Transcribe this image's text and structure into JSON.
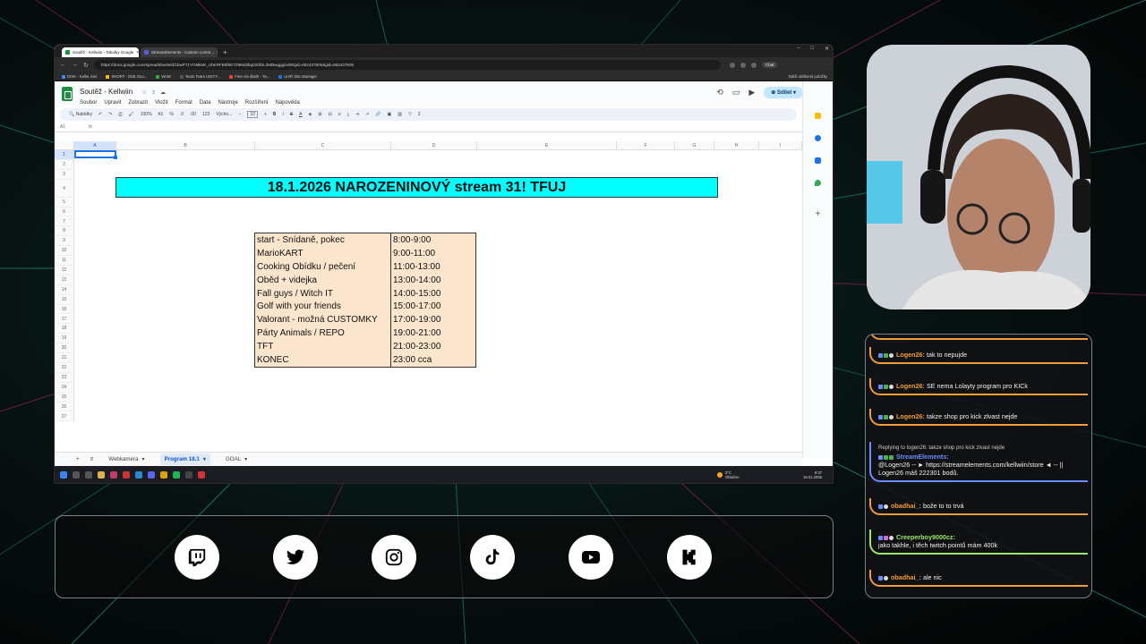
{
  "browser": {
    "tabs": [
      {
        "label": "Soutěž - Kellwiin - Tabulky Google",
        "color": "#1e8e3e",
        "active": true
      },
      {
        "label": "StreamElements - Custom comm...",
        "color": "#5b5bd6",
        "active": false
      }
    ],
    "url": "https://docs.google.com/spreadsheets/d/1bwP71YOMkMr_UhKRFB0f5E7Z9Md3bq020fSL3MBwggg/edit#gid=662437605&gid=662437605",
    "chat_button": "Chat",
    "bookmarks": [
      {
        "label": "DISK - Kellw. Kiei",
        "color": "#4285f4"
      },
      {
        "label": "SHORT - Disk Goo...",
        "color": "#fbbc04"
      },
      {
        "label": "WoW",
        "color": "#34a853"
      },
      {
        "label": "Team Team UNITY...",
        "color": "#555555"
      },
      {
        "label": "Free elo dlash - Ta...",
        "color": "#ea4335"
      },
      {
        "label": "UniFi Site Manager",
        "color": "#1a73e8"
      }
    ],
    "bookmarks_right": "Další oblíbené položky"
  },
  "sheet": {
    "title": "Soutěž - Kellwiin",
    "menus": [
      "Soubor",
      "Upravit",
      "Zobrazit",
      "Vložit",
      "Formát",
      "Data",
      "Nástroje",
      "Rozšíření",
      "Nápověda"
    ],
    "share_label": "Sdílet",
    "toolbar": {
      "search": "Nabídky",
      "zoom": "100%",
      "currency": "Kč",
      "percent": "%",
      "num_format": "123",
      "font": "Výcho...",
      "font_size": "10"
    },
    "cell_ref": "A1",
    "fx": "fx",
    "columns": [
      "A",
      "B",
      "C",
      "D",
      "E",
      "F",
      "G",
      "H",
      "I"
    ],
    "rows": [
      "1",
      "2",
      "3",
      "4",
      "5",
      "6",
      "7",
      "8",
      "9",
      "10",
      "11",
      "12",
      "13",
      "14",
      "15",
      "16",
      "17",
      "18",
      "19",
      "20",
      "21",
      "22",
      "23",
      "24",
      "25",
      "26",
      "27"
    ],
    "banner": "18.1.2026 NAROZENINOVÝ stream 31! TFUJ",
    "banner_color": "#00ffff",
    "schedule": [
      {
        "activity": "start - Snídaně, pokec",
        "time": "8:00-9:00"
      },
      {
        "activity": "MarioKART",
        "time": "9:00-11:00"
      },
      {
        "activity": "Cooking Obídku / pečení",
        "time": "11:00-13:00"
      },
      {
        "activity": "Oběd + videjka",
        "time": "13:00-14:00"
      },
      {
        "activity": "Fall guys / Witch IT",
        "time": "14:00-15:00"
      },
      {
        "activity": "Golf with your friends",
        "time": "15:00-17:00"
      },
      {
        "activity": "Valorant - možná CUSTOMKY",
        "time": "17:00-19:00"
      },
      {
        "activity": "Párty Animals / REPO",
        "time": "19:00-21:00"
      },
      {
        "activity": "TFT",
        "time": "21:00-23:00"
      },
      {
        "activity": "KONEC",
        "time": "23:00 cca"
      }
    ],
    "schedule_color": "#fce5cd",
    "sheet_tabs": [
      "Webkamera",
      "Program 18.1",
      "GOAL"
    ],
    "active_sheet_tab": "Program 18.1"
  },
  "taskbar": {
    "weather_temp": "3°C",
    "weather_desc": "Oblačno",
    "time": "9:37",
    "date": "18.01.2026"
  },
  "chat": {
    "messages": [
      {
        "user": "Logen26:",
        "text": "tak to nepujde",
        "accent": "#f29b38"
      },
      {
        "user": "Logen26:",
        "text": "SE nema Lolayty program pro KICk",
        "accent": "#f29b38"
      },
      {
        "user": "Logen26:",
        "text": "takze shop pro kick zlvast nejde",
        "accent": "#f29b38"
      },
      {
        "reply_to": "Replying to logen26: takze shop pro kick zlvast nejde",
        "user": "StreamElements:",
        "text": "@Logen26 -- ► https://streamelements.com/kellwiin/store ◄ -- || Logen26 máš 222301 bodů.",
        "accent": "#6b8cff"
      },
      {
        "user": "obadhai_:",
        "text": "bože to to trvá",
        "accent": "#f29b38"
      },
      {
        "user": "Creeperboy9000cz:",
        "text": "jako takhle, i těch twitch pointů mám 400k",
        "accent": "#9ae86a"
      },
      {
        "user": "obadhai_:",
        "text": "ale nic",
        "accent": "#f29b38"
      }
    ]
  },
  "social": {
    "icons": [
      "twitch-icon",
      "twitter-icon",
      "instagram-icon",
      "tiktok-icon",
      "youtube-icon",
      "kick-icon"
    ]
  }
}
